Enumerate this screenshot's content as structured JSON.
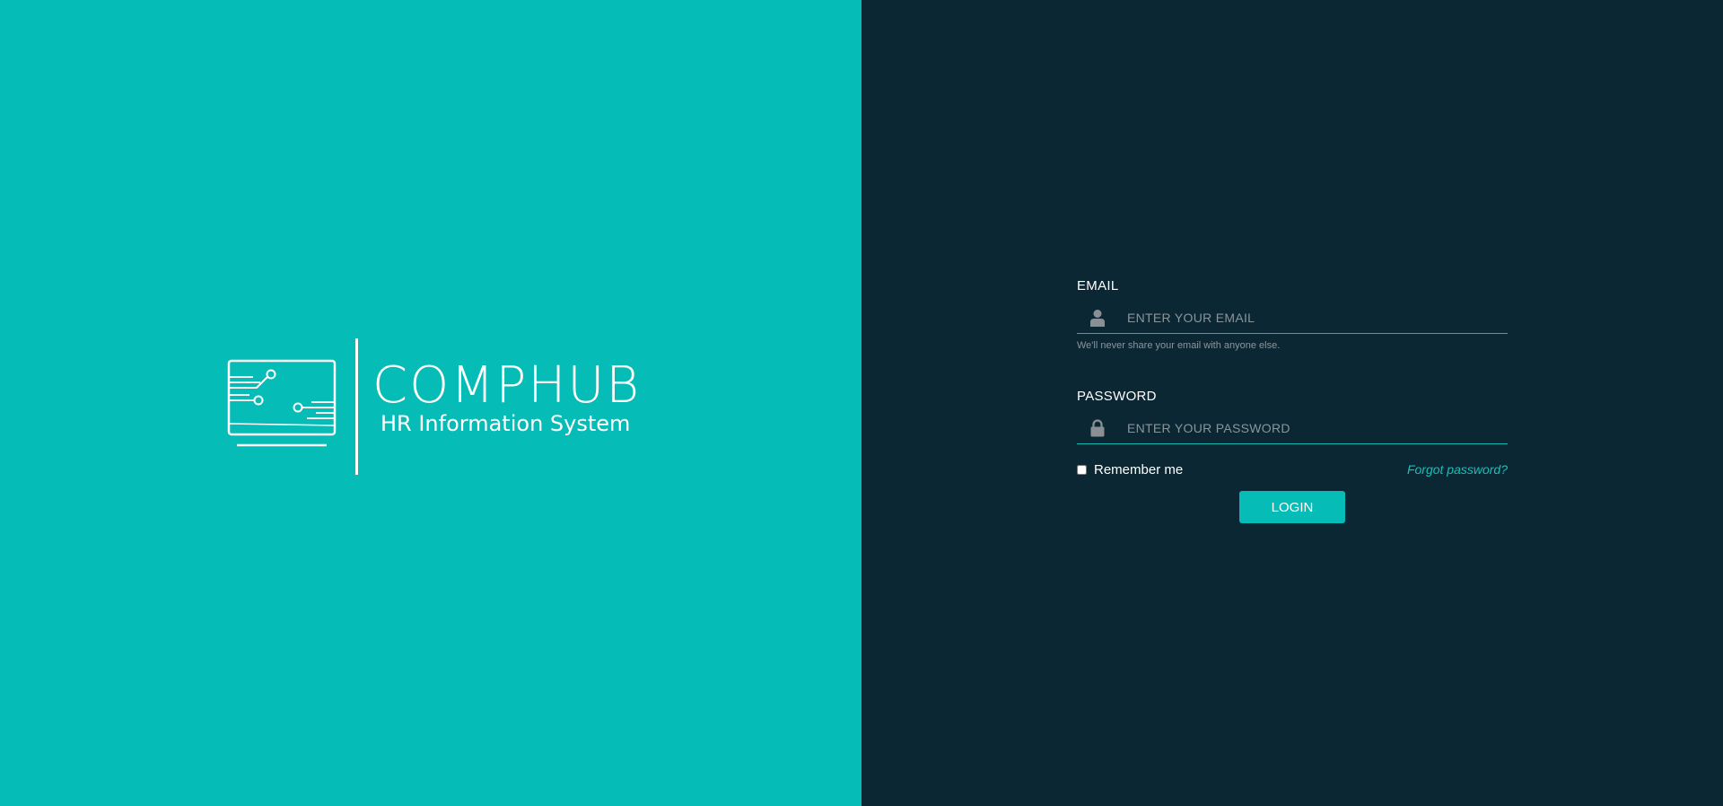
{
  "brand": {
    "title": "COMPHUB",
    "subtitle": "HR Information System"
  },
  "colors": {
    "left_panel": "#06bcb6",
    "right_panel": "#0c2734",
    "accent": "#06bcb6",
    "link": "#14c1ba"
  },
  "login": {
    "email": {
      "label": "EMAIL",
      "placeholder": "ENTER YOUR EMAIL",
      "value": "",
      "icon": "user-icon",
      "help": "We'll never share your email with anyone else."
    },
    "password": {
      "label": "PASSWORD",
      "placeholder": "ENTER YOUR PASSWORD",
      "value": "",
      "icon": "lock-icon"
    },
    "remember_label": "Remember me",
    "remember_checked": false,
    "forgot_label": "Forgot password?",
    "submit_label": "LOGIN"
  }
}
